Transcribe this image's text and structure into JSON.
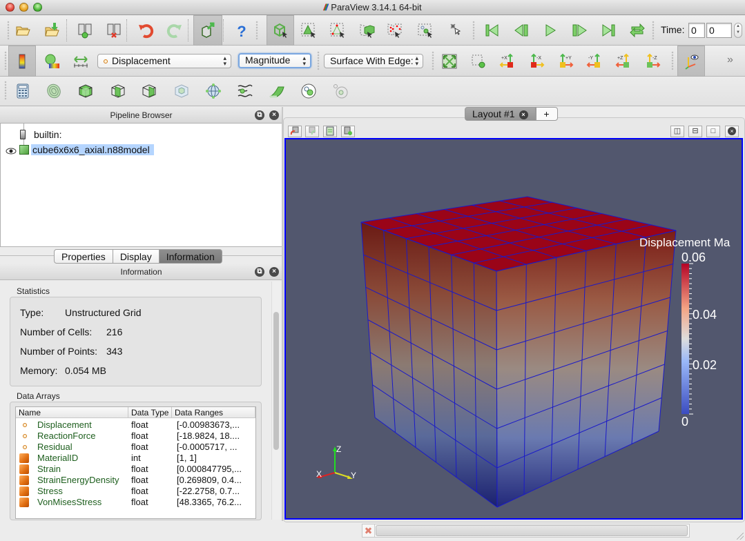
{
  "window": {
    "title": "ParaView 3.14.1 64-bit",
    "logo_text": "///"
  },
  "toolbar_main": {
    "buttons": [
      {
        "id": "open",
        "icon": "folder-open-icon"
      },
      {
        "id": "load-state",
        "icon": "folder-load-icon"
      },
      {
        "id": "connect",
        "icon": "server-connect-icon"
      },
      {
        "id": "disconnect",
        "icon": "server-disconnect-icon"
      },
      {
        "id": "undo",
        "icon": "undo-icon"
      },
      {
        "id": "redo",
        "icon": "redo-icon"
      },
      {
        "id": "camera-link",
        "icon": "server-camera-icon"
      },
      {
        "id": "help",
        "icon": "help-icon"
      },
      {
        "id": "interact",
        "icon": "interact-cube-icon"
      },
      {
        "id": "select-cells-on",
        "icon": "select-cells-icon"
      },
      {
        "id": "select-points-on",
        "icon": "select-points-icon"
      },
      {
        "id": "select-cells-through",
        "icon": "select-frustum-cells-icon"
      },
      {
        "id": "select-points-through",
        "icon": "select-frustum-points-icon"
      },
      {
        "id": "select-block",
        "icon": "select-block-icon"
      },
      {
        "id": "clear-selection",
        "icon": "clear-selection-icon"
      },
      {
        "id": "first-frame",
        "icon": "first-frame-icon"
      },
      {
        "id": "previous-frame",
        "icon": "previous-frame-icon"
      },
      {
        "id": "play",
        "icon": "play-icon"
      },
      {
        "id": "next-frame",
        "icon": "next-frame-icon"
      },
      {
        "id": "last-frame",
        "icon": "last-frame-icon"
      },
      {
        "id": "loop",
        "icon": "loop-icon"
      }
    ],
    "time_label": "Time:",
    "time_value": "0",
    "time_index": "0"
  },
  "toolbar_display": {
    "color_array": "Displacement",
    "component": "Magnitude",
    "representation": "Surface With Edges",
    "representation_visible": "Surface With Edge:",
    "camera_buttons": [
      "+X",
      "-X",
      "+Y",
      "-Y",
      "+Z",
      "-Z"
    ],
    "overflow_label": "»"
  },
  "toolbar_filters": {
    "buttons": [
      "calculator",
      "contour",
      "clip",
      "slice",
      "threshold",
      "extract-subset",
      "glyph",
      "stream-tracer",
      "warp-by-vector",
      "group-datasets",
      "extract-level"
    ]
  },
  "pipeline_browser": {
    "title": "Pipeline Browser",
    "items": [
      {
        "label": "builtin:",
        "type": "server"
      },
      {
        "label": "cube6x6x6_axial.n88model",
        "type": "source",
        "visible": true,
        "selected": true
      }
    ]
  },
  "panel_tabs": {
    "tabs": [
      "Properties",
      "Display",
      "Information"
    ],
    "active": "Information"
  },
  "information": {
    "title": "Information",
    "statistics_label": "Statistics",
    "statistics": [
      {
        "label": "Type:",
        "value": "Unstructured Grid"
      },
      {
        "label": "Number of Cells:",
        "value": "216"
      },
      {
        "label": "Number of Points:",
        "value": "343"
      },
      {
        "label": "Memory:",
        "value": "0.054 MB"
      }
    ],
    "arrays_label": "Data Arrays",
    "columns": [
      "Name",
      "Data Type",
      "Data Ranges"
    ],
    "arrays": [
      {
        "name": "Displacement",
        "kind": "point",
        "type": "float",
        "range": "[-0.00983673,..."
      },
      {
        "name": "ReactionForce",
        "kind": "point",
        "type": "float",
        "range": "[-18.9824, 18...."
      },
      {
        "name": "Residual",
        "kind": "point",
        "type": "float",
        "range": "[-0.0005717, ..."
      },
      {
        "name": "MaterialID",
        "kind": "cell",
        "type": "int",
        "range": "[1, 1]"
      },
      {
        "name": "Strain",
        "kind": "cell",
        "type": "float",
        "range": "[0.000847795,..."
      },
      {
        "name": "StrainEnergyDensity",
        "kind": "cell",
        "type": "float",
        "range": "[0.269809, 0.4..."
      },
      {
        "name": "Stress",
        "kind": "cell",
        "type": "float",
        "range": "[-22.2758, 0.7..."
      },
      {
        "name": "VonMisesStress",
        "kind": "cell",
        "type": "float",
        "range": "[48.3365, 76.2..."
      }
    ]
  },
  "layout": {
    "tabs": [
      "Layout #1"
    ],
    "add_tab_label": "+",
    "view_buttons": [
      "split-horizontal",
      "split-vertical",
      "maximize",
      "close"
    ]
  },
  "render_view": {
    "background_color": "#52576e",
    "border_color": "#0000ff",
    "mesh_cells_per_edge": 6,
    "scalar_bar": {
      "title": "Displacement Ma",
      "title_full": "Displacement Magnitude",
      "ticks": [
        "0.06",
        "0.04",
        "0.02",
        "0"
      ],
      "range": [
        0,
        0.06
      ],
      "colors": [
        "#3b4cc0",
        "#dddddd",
        "#b40426"
      ]
    },
    "axes": {
      "x": "X",
      "y": "Y",
      "z": "Z"
    }
  },
  "status_bar": {
    "progress": 0
  }
}
